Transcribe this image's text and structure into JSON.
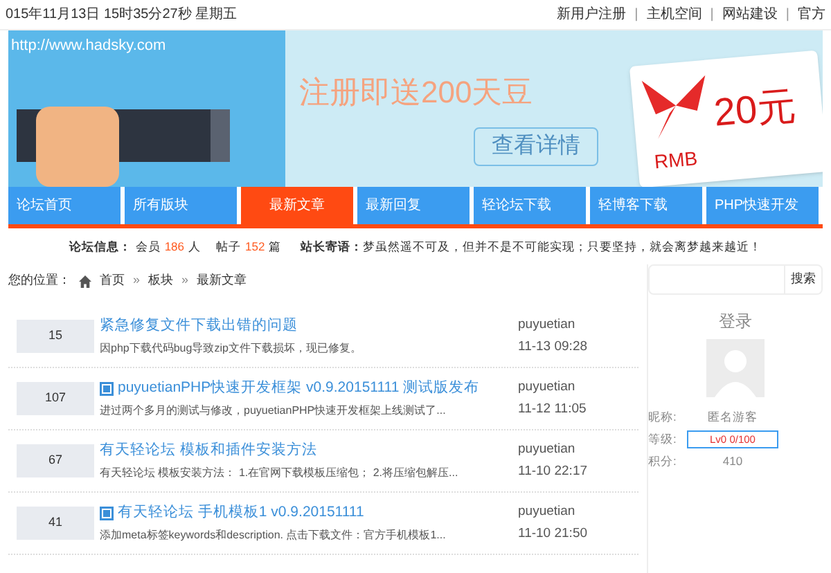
{
  "top_bar": {
    "datetime": "015年11月13日 15时35分27秒 星期五",
    "links": [
      "新用户注册",
      "主机空间",
      "网站建设",
      "官方"
    ],
    "separator": "|"
  },
  "banner": {
    "url": "http://www.hadsky.com",
    "headline": "注册即送200天豆",
    "button": "查看详情",
    "card_amount": "20元",
    "card_currency": "RMB"
  },
  "nav": [
    {
      "label": "论坛首页",
      "selected": false
    },
    {
      "label": "所有版块",
      "selected": false
    },
    {
      "label": "最新文章",
      "selected": true
    },
    {
      "label": "最新回复",
      "selected": false
    },
    {
      "label": "轻论坛下载",
      "selected": false
    },
    {
      "label": "轻博客下载",
      "selected": false
    },
    {
      "label": "PHP快速开发",
      "selected": false
    }
  ],
  "info_bar": {
    "forum_label": "论坛信息：",
    "members_prefix": "会员",
    "members": "186",
    "members_unit": "人",
    "posts_prefix": "帖子",
    "posts": "152",
    "posts_unit": "篇",
    "motto_label": "站长寄语：",
    "motto": "梦虽然遥不可及，但并不是不可能实现；只要坚持，就会离梦越来越近！"
  },
  "breadcrumb": {
    "label": "您的位置：",
    "items": [
      "首页",
      "板块",
      "最新文章"
    ],
    "separator": "»"
  },
  "posts": [
    {
      "count": "15",
      "has_icon": false,
      "title": "紧急修复文件下载出错的问题",
      "excerpt": "因php下载代码bug导致zip文件下载损坏，现已修复。",
      "author": "puyuetian",
      "time": "11-13 09:28"
    },
    {
      "count": "107",
      "has_icon": true,
      "title": "puyuetianPHP快速开发框架 v0.9.20151111 测试版发布",
      "excerpt": "进过两个多月的测试与修改，puyuetianPHP快速开发框架上线测试了...",
      "author": "puyuetian",
      "time": "11-12 11:05"
    },
    {
      "count": "67",
      "has_icon": false,
      "title": "有天轻论坛 模板和插件安装方法",
      "excerpt": "有天轻论坛 模板安装方法： 1.在官网下载模板压缩包； 2.将压缩包解压...",
      "author": "puyuetian",
      "time": "11-10 22:17"
    },
    {
      "count": "41",
      "has_icon": true,
      "title": "有天轻论坛 手机模板1 v0.9.20151111",
      "excerpt": "添加meta标签keywords和description. 点击下载文件：官方手机模板1...",
      "author": "puyuetian",
      "time": "11-10 21:50"
    }
  ],
  "sidebar": {
    "search_button": "搜索",
    "login_title": "登录",
    "fields": [
      {
        "kind": "text",
        "label": "昵称:",
        "value": "匿名游客"
      },
      {
        "kind": "badge",
        "label": "等级:",
        "value": "Lv0 0/100"
      },
      {
        "kind": "text",
        "label": "积分:",
        "value": "410"
      }
    ]
  }
}
